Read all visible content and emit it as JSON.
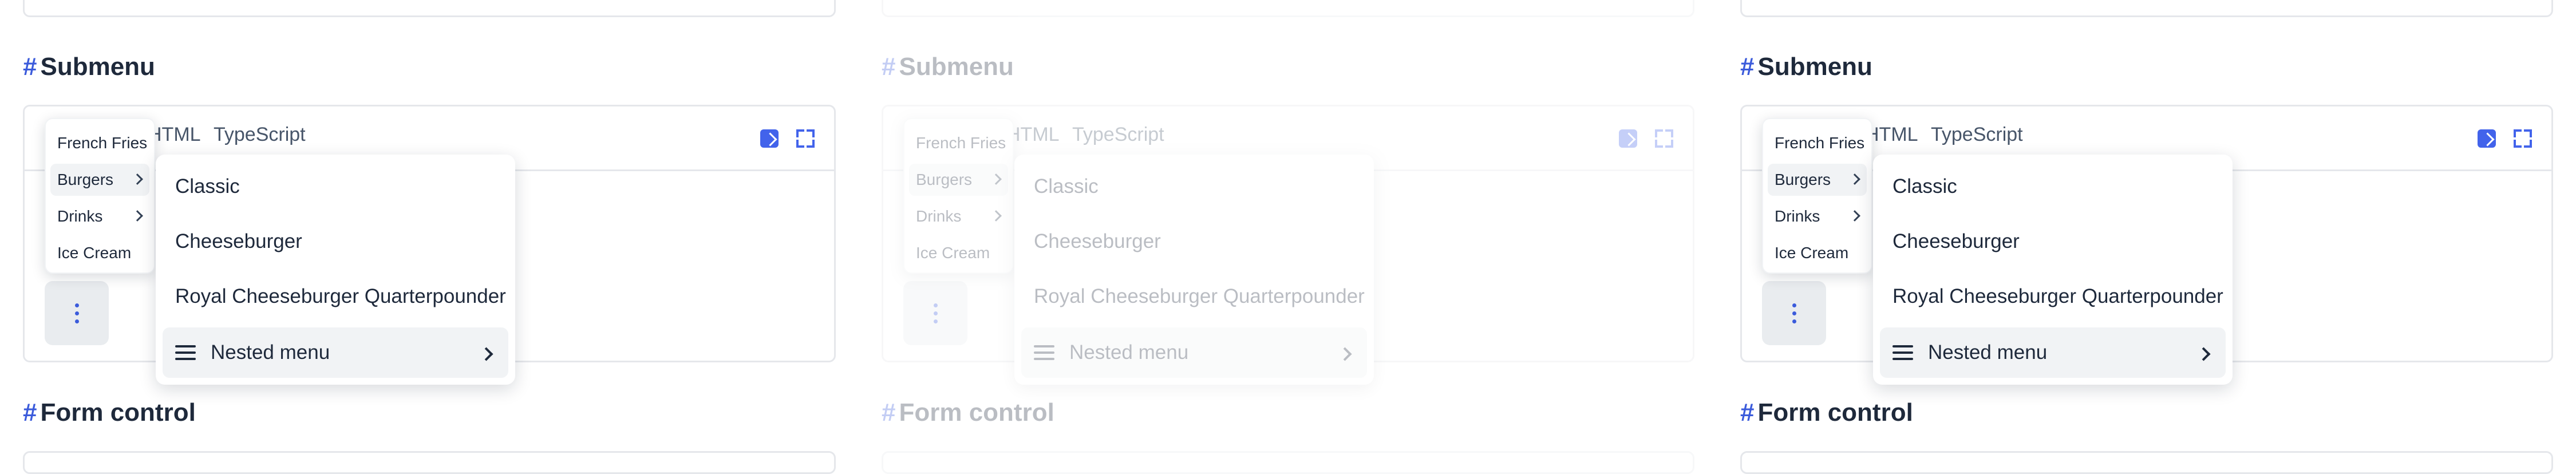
{
  "panels": [
    {
      "section_title": "Submenu",
      "next_section_title": "Form control",
      "tabs": [
        "HTML",
        "TypeScript"
      ],
      "menu": {
        "items": [
          "French Fries",
          "Burgers",
          "Drinks",
          "Ice Cream"
        ],
        "active_item": "Burgers"
      },
      "submenu": {
        "items": [
          "Classic",
          "Cheeseburger",
          "Royal Cheeseburger Quarterpounder"
        ],
        "nested_label": "Nested menu"
      }
    },
    {
      "section_title": "Submenu",
      "next_section_title": "Form control",
      "tabs": [
        "HTML",
        "TypeScript"
      ],
      "menu": {
        "items": [
          "French Fries",
          "Burgers",
          "Drinks",
          "Ice Cream"
        ],
        "active_item": "Burgers"
      },
      "submenu": {
        "items": [
          "Classic",
          "Cheeseburger",
          "Royal Cheeseburger Quarterpounder"
        ],
        "nested_label": "Nested menu"
      }
    },
    {
      "section_title": "Submenu",
      "next_section_title": "Form control",
      "tabs": [
        "HTML",
        "TypeScript"
      ],
      "menu": {
        "items": [
          "French Fries",
          "Burgers",
          "Drinks",
          "Ice Cream"
        ],
        "active_item": "Burgers"
      },
      "submenu": {
        "items": [
          "Classic",
          "Cheeseburger",
          "Royal Cheeseburger Quarterpounder"
        ],
        "nested_label": "Nested menu"
      }
    }
  ],
  "icons": {
    "heading_hash": "#",
    "open_in_new": "external-link-icon",
    "fullscreen": "fullscreen-icon",
    "more": "more-vertical-icon",
    "nested": "menu-lines-icon",
    "chevron": "chevron-right-icon"
  },
  "colors": {
    "accent": "#3b5bdb",
    "hover_bg": "#f1f3f5",
    "border": "#e5e7eb"
  }
}
